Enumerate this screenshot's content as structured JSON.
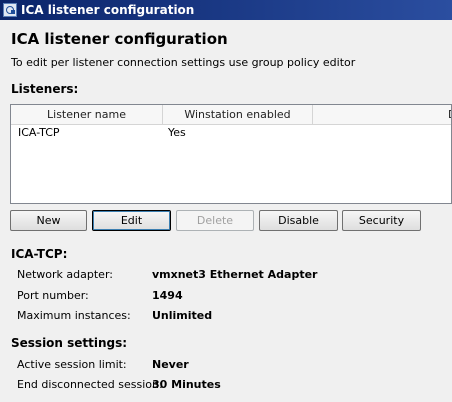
{
  "window": {
    "title": "ICA listener configuration",
    "icon": "app-icon"
  },
  "heading": "ICA listener configuration",
  "description": "To edit per listener connection settings use group policy editor",
  "listeners": {
    "title": "Listeners:",
    "columns": [
      "Listener name",
      "Winstation enabled",
      "Des"
    ],
    "rows": [
      {
        "name": "ICA-TCP",
        "enabled": "Yes",
        "description": ""
      }
    ]
  },
  "buttons": {
    "new": "New",
    "edit": "Edit",
    "delete": "Delete",
    "disable": "Disable",
    "security": "Security"
  },
  "listener_details": {
    "title": "ICA-TCP:",
    "network_adapter_label": "Network adapter:",
    "network_adapter_value": "vmxnet3 Ethernet Adapter",
    "port_label": "Port number:",
    "port_value": "1494",
    "max_instances_label": "Maximum instances:",
    "max_instances_value": "Unlimited"
  },
  "session_settings": {
    "title": "Session settings:",
    "active_limit_label": "Active session limit:",
    "active_limit_value": "Never",
    "end_disconnected_label": "End disconnected session:",
    "end_disconnected_value": "30 Minutes"
  }
}
